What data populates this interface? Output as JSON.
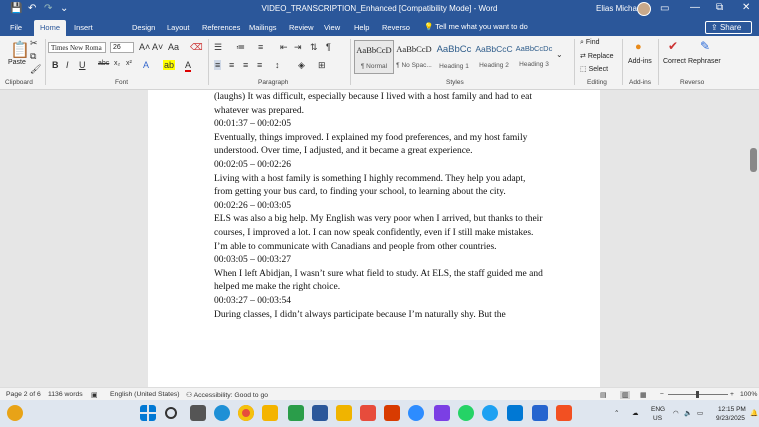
{
  "window": {
    "title": "VIDEO_TRANSCRIPTION_Enhanced [Compatibility Mode]  -  Word",
    "user": "Elias Michael",
    "share_label": "Share"
  },
  "tabs": [
    "File",
    "Home",
    "Insert",
    "Design",
    "Layout",
    "References",
    "Mailings",
    "Review",
    "View",
    "Help",
    "Reverso"
  ],
  "tell_me": "Tell me what you want to do",
  "ribbon": {
    "paste_label": "Paste",
    "font_name": "Times New Roma",
    "font_size": "26",
    "styles": [
      {
        "preview": "AaBbCcD",
        "name": "¶ Normal"
      },
      {
        "preview": "AaBbCcD",
        "name": "¶ No Spac..."
      },
      {
        "preview": "AaBbCc",
        "name": "Heading 1"
      },
      {
        "preview": "AaBbCcC",
        "name": "Heading 2"
      },
      {
        "preview": "AaBbCcDc",
        "name": "Heading 3"
      }
    ],
    "find": "Find",
    "replace": "Replace",
    "select": "Select",
    "addins": "Add-ins",
    "correct": "Correct",
    "rephraser": "Rephraser",
    "groups": {
      "clipboard": "Clipboard",
      "font": "Font",
      "paragraph": "Paragraph",
      "styles": "Styles",
      "editing": "Editing",
      "addins": "Add-ins",
      "reverso": "Reverso"
    }
  },
  "document": {
    "blocks": [
      {
        "timestamp": "",
        "text": "(laughs) It was difficult, especially because I lived with a host family and had to eat whatever was prepared."
      },
      {
        "timestamp": "00:01:37 – 00:02:05",
        "text": "Eventually, things improved. I explained my food preferences, and my host family understood. Over time, I adjusted, and it became a great experience."
      },
      {
        "timestamp": "00:02:05 – 00:02:26",
        "text": "Living with a host family is something I highly recommend. They help you adapt, from getting your bus card, to finding your school, to learning about the city."
      },
      {
        "timestamp": "00:02:26 – 00:03:05",
        "text": "ELS was also a big help. My English was very poor when I arrived, but thanks to their courses, I improved a lot. I can now speak confidently, even if I still make mistakes. I’m able to communicate with Canadians and people from other countries."
      },
      {
        "timestamp": "00:03:05 – 00:03:27",
        "text": "When I left Abidjan, I wasn’t sure what field to study. At ELS, the staff guided me and helped me make the right choice."
      },
      {
        "timestamp": "00:03:27 – 00:03:54",
        "text": "During classes, I didn’t always participate because I’m naturally shy. But the"
      }
    ]
  },
  "status": {
    "page": "Page 2 of 6",
    "words": "1136 words",
    "language": "English (United States)",
    "accessibility": "Accessibility: Good to go",
    "zoom": "100%"
  },
  "tray": {
    "lang1": "ENG",
    "lang2": "US",
    "time": "12:15 PM",
    "date": "9/23/2025"
  },
  "colors": {
    "word_blue": "#2b579a"
  }
}
